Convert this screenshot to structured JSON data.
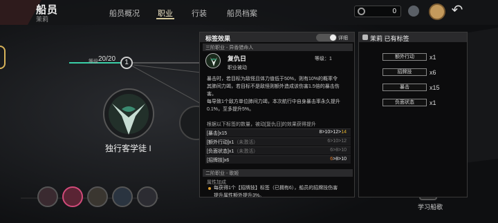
{
  "header": {
    "title": "船员",
    "subtitle": "茉莉",
    "tabs": [
      "船员概况",
      "职业",
      "行装",
      "船员档案"
    ],
    "counter_value": "0"
  },
  "crew": {
    "level_label": "等级",
    "level_value": "20/20",
    "next_node": "1",
    "class_name": "独行客学徒 I",
    "learn_label": "学习船歌"
  },
  "tag_panel": {
    "title": "标签效果",
    "detail_label": "详细",
    "tier3_label": "三阶职业 - 异香猎命人",
    "skill": {
      "name": "复仇日",
      "level": "等级：1",
      "type": "职业被动"
    },
    "description_lines": [
      "暴击时，若目标为敌怪且体力值低于50%，则有10%的概率令",
      "其肺间力竭，若目标不是敌怪则额外造成该伤害1.5倍的暴击伤",
      "害。",
      "每导致1个敌方单位肺间力竭，本次航行中自身暴击率永久提升",
      "0.1%，至多提升5%。"
    ],
    "scale_note": "根据以下标签的数量，被动[复仇日]的效果获得提升",
    "rows": [
      {
        "label": "[暴击]x15",
        "note": "",
        "left": "8>10>12>",
        "highlight": "14",
        "highlight_color": "gold",
        "right": ""
      },
      {
        "label": "[额外行动]x1",
        "note": "（未激活）",
        "left": "",
        "highlight": "",
        "highlight_color": "",
        "right": "6>10>12"
      },
      {
        "label": "[负面状态]x1",
        "note": "（未激活）",
        "left": "",
        "highlight": "",
        "highlight_color": "",
        "right": "6>8>10"
      },
      {
        "label": "[招牌技]x6",
        "note": "",
        "left": "",
        "highlight": "6",
        "highlight_color": "orange",
        "right": ">8>10"
      }
    ],
    "tier2_label": "二阶职业 - 歌姬",
    "attr_label": "属性加成",
    "attr_text_lines": [
      "每获得1个【招牌技】标签（已拥有6），船员的招牌技伤害",
      "提升属性额外提升3%。"
    ]
  },
  "owned_tags": {
    "title": "茉莉 已有标签",
    "tags": [
      {
        "name": "额外行动",
        "count": "x1"
      },
      {
        "name": "招牌技",
        "count": "x6"
      },
      {
        "name": "暴击",
        "count": "x15"
      },
      {
        "name": "负面状态",
        "count": "x1"
      }
    ]
  },
  "colors": {
    "accent_gold": "#e0b030",
    "accent_orange": "#e07a2a",
    "panel_bg": "#0c0c0d"
  }
}
